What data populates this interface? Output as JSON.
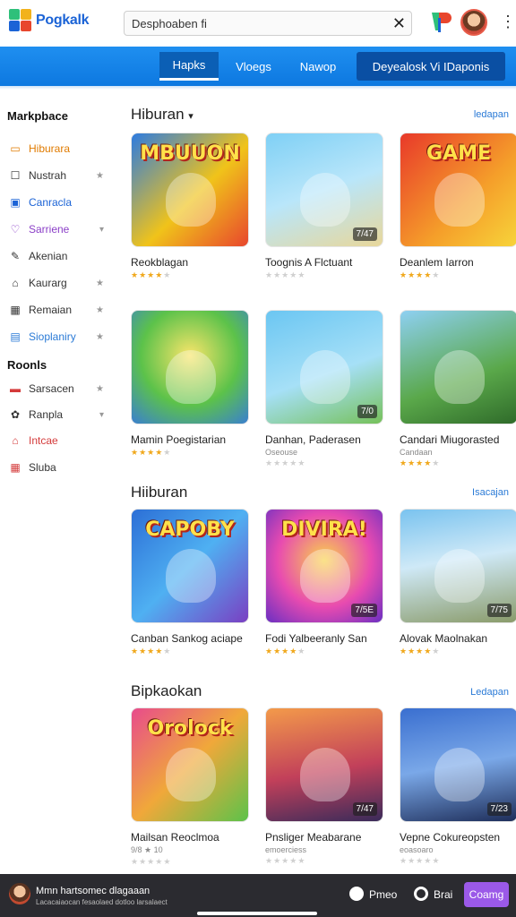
{
  "header": {
    "app_name": "Pogkalk",
    "search_value": "Desphoaben fi",
    "clear_glyph": "✕",
    "brand_icon": "brand-logo-icon",
    "menu_glyph": "⋮"
  },
  "nav": {
    "tabs": [
      {
        "label": "Hapks",
        "active": true
      },
      {
        "label": "Vloegs",
        "active": false
      },
      {
        "label": "Nawop",
        "active": false
      }
    ],
    "cta_label": "Deyealosk Vi IDaponis"
  },
  "sidebar": {
    "heading_1": "Markpbace",
    "items_1": [
      {
        "label": "Hiburara",
        "icon": "window-icon",
        "glyph": "▭",
        "color": "#e07b00",
        "suffix": ""
      },
      {
        "label": "Nustrah",
        "icon": "square-icon",
        "glyph": "☐",
        "color": "#333333",
        "suffix": "★"
      },
      {
        "label": "Canracla",
        "icon": "media-icon",
        "glyph": "▣",
        "color": "#1b63d6",
        "suffix": ""
      },
      {
        "label": "Sarriene",
        "icon": "chat-icon",
        "glyph": "♡",
        "color": "#8b3fc7",
        "suffix": "▾"
      },
      {
        "label": "Akenian",
        "icon": "pen-icon",
        "glyph": "✎",
        "color": "#333333",
        "suffix": ""
      },
      {
        "label": "Kaurarg",
        "icon": "tag-icon",
        "glyph": "⌂",
        "color": "#333333",
        "suffix": "★"
      },
      {
        "label": "Remaian",
        "icon": "grid-icon",
        "glyph": "▦",
        "color": "#333333",
        "suffix": "★"
      },
      {
        "label": "Sioplaniry",
        "icon": "list-icon",
        "glyph": "▤",
        "color": "#2a7ad6",
        "suffix": "★"
      }
    ],
    "heading_2": "Roonls",
    "items_2": [
      {
        "label": "Sarsacen",
        "icon": "card-icon",
        "glyph": "▬",
        "color": "#d43b3b",
        "suffix": "★"
      },
      {
        "label": "Ranpla",
        "icon": "group-icon",
        "glyph": "✿",
        "color": "#333333",
        "suffix": "▾"
      },
      {
        "label": "Intcae",
        "icon": "home-icon",
        "glyph": "⌂",
        "color": "#d43b3b",
        "suffix": ""
      },
      {
        "label": "Sluba",
        "icon": "grid-small-icon",
        "glyph": "▦",
        "color": "#d43b3b",
        "suffix": ""
      }
    ]
  },
  "sections": [
    {
      "title": "Hiburan",
      "chevron": "▾",
      "link": "ledapan",
      "cards": [
        {
          "title": "Reokblagan",
          "sub": "",
          "stars": 4,
          "badge": "",
          "art": "MBUUON",
          "bg": "linear-gradient(135deg,#2d7be0,#f0c31a 55%,#e8462d)"
        },
        {
          "title": "Toognis A Flctuant",
          "sub": "",
          "stars": 0,
          "badge": "7/47",
          "art": "",
          "bg": "linear-gradient(160deg,#7fd0f5,#b9e6fa 50%,#e8d79a)"
        },
        {
          "title": "Deanlem Iarron",
          "sub": "",
          "stars": 4,
          "badge": "",
          "art": "GAME",
          "bg": "linear-gradient(135deg,#e8392a,#f59f2a 60%,#f7d43a)"
        }
      ]
    },
    {
      "title": "",
      "chevron": "",
      "link": "",
      "cards": [
        {
          "title": "Mamin Poegistarian",
          "sub": "",
          "stars": 4,
          "badge": "",
          "art": "",
          "bg": "radial-gradient(circle at 50% 40%,#f9e56a,#5cc24a 55%,#3a7fd0)"
        },
        {
          "title": "Danhan, Paderasen",
          "sub": "Oseouse",
          "stars": 0,
          "badge": "7/0",
          "art": "",
          "bg": "linear-gradient(160deg,#6bc6f2,#a6e0f7 55%,#76c15a)"
        },
        {
          "title": "Candari Miugorasted",
          "sub": "Candaan",
          "stars": 4,
          "badge": "",
          "art": "",
          "bg": "linear-gradient(160deg,#8ed0f2,#5aa84a 60%,#2f6b2a)"
        }
      ]
    },
    {
      "title": "Hiiburan",
      "chevron": "",
      "link": "Isacajan",
      "cards": [
        {
          "title": "Canban Sankog aciape",
          "sub": "",
          "stars": 4,
          "badge": "",
          "art": "CAPOBY",
          "bg": "linear-gradient(135deg,#2c6fd6,#4fb0f2 50%,#7a3fc2)"
        },
        {
          "title": "Fodi Yalbeeranly San",
          "sub": "",
          "stars": 4,
          "badge": "7/5E",
          "art": "DIVIRA!",
          "bg": "radial-gradient(circle at 50% 45%,#f9d34a,#e84bb0 55%,#6a2fc2)"
        },
        {
          "title": "Alovak Maolnakan",
          "sub": "",
          "stars": 4,
          "badge": "7/75",
          "art": "",
          "bg": "linear-gradient(170deg,#7ac3ef,#cfe9f7 45%,#8a9b6a)"
        }
      ]
    },
    {
      "title": "Bipkaokan",
      "chevron": "",
      "link": "Ledapan",
      "cards": [
        {
          "title": "Mailsan Reoclmoa",
          "sub": "9/8 ★ 10",
          "stars": 0,
          "badge": "",
          "art": "Orolock",
          "bg": "linear-gradient(135deg,#e84b8c,#f0a83a 50%,#5cc24a)"
        },
        {
          "title": "Pnsliger Meabarane",
          "sub": "emoerciess",
          "stars": 0,
          "badge": "7/47",
          "art": "",
          "bg": "linear-gradient(170deg,#f39a4a,#c2405a 55%,#3a2b5a)"
        },
        {
          "title": "Vepne Cokureopsten",
          "sub": "eoasoaro",
          "stars": 0,
          "badge": "7/23",
          "art": "",
          "bg": "linear-gradient(170deg,#3a6fd0,#7aa8e8 50%,#1e2e5a)"
        }
      ]
    }
  ],
  "bottom": {
    "title": "Mmn hartsomec dlagaaan",
    "subtitle": "Lacacaiaocan fesaolaed dotloo larsalaect",
    "chat_label": "Pmeo",
    "status_label": "Brai",
    "button_label": "Coamg"
  },
  "colors": {
    "accent": "#0d78e0",
    "cta": "#0a4fa3",
    "star": "#f0a81c",
    "button": "#9b59e8"
  }
}
